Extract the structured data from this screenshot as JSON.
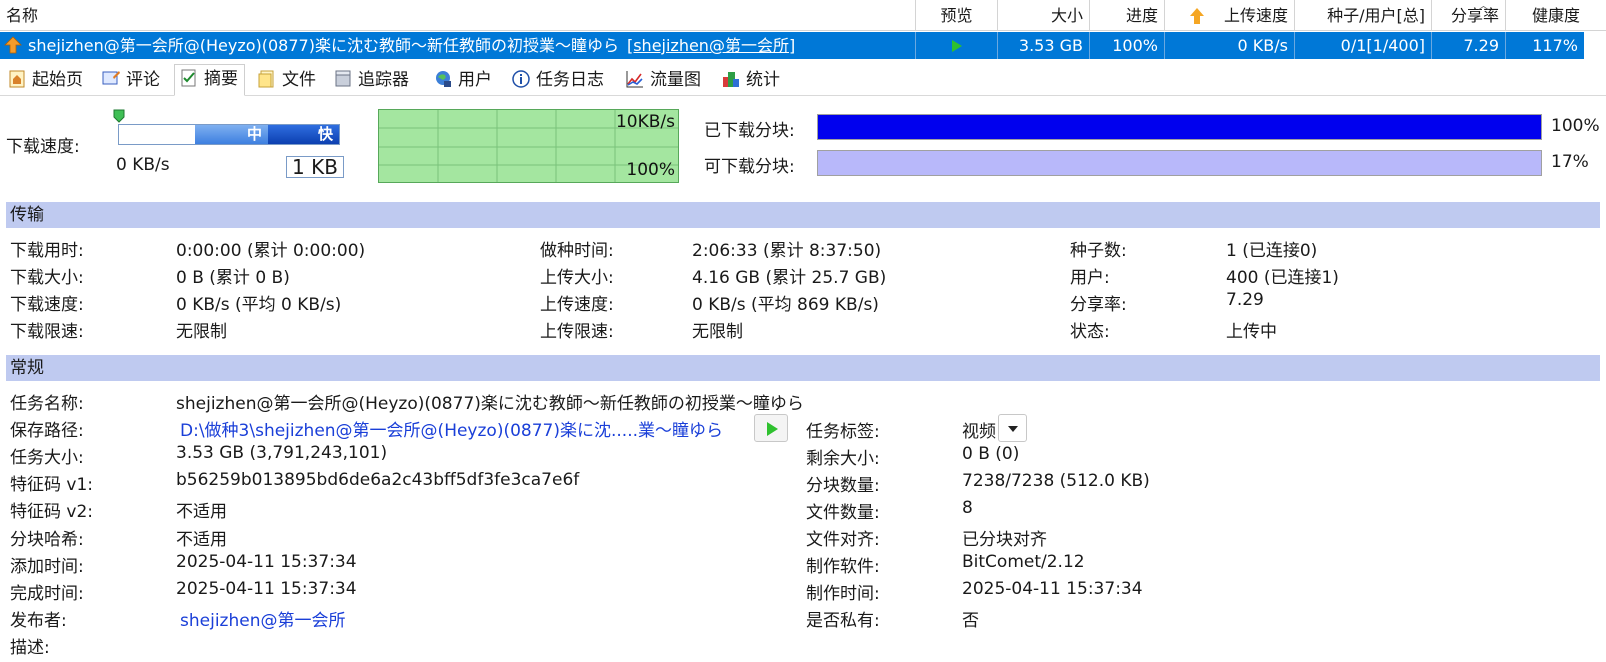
{
  "list": {
    "headers": {
      "name": "名称",
      "preview": "预览",
      "size": "大小",
      "progress": "进度",
      "upload_speed": "上传速度",
      "seeds_peers": "种子/用户[总]",
      "share_ratio": "分享率",
      "health": "健康度"
    },
    "row": {
      "name": "shejizhen@第一会所@(Heyzo)(0877)楽に沈む教師～新任教師の初授業～瞳ゆら",
      "tag": "[shejizhen@第一会所]",
      "size": "3.53 GB",
      "progress": "100%",
      "upload_speed": "0 KB/s",
      "seeds_peers": "0/1[1/400]",
      "share_ratio": "7.29",
      "health": "117%"
    }
  },
  "tabs": [
    {
      "label": "起始页",
      "icon": "home-icon"
    },
    {
      "label": "评论",
      "icon": "comment-icon"
    },
    {
      "label": "摘要",
      "icon": "summary-icon",
      "active": true
    },
    {
      "label": "文件",
      "icon": "file-icon"
    },
    {
      "label": "追踪器",
      "icon": "tracker-icon"
    },
    {
      "label": "用户",
      "icon": "peers-icon"
    },
    {
      "label": "任务日志",
      "icon": "info-icon"
    },
    {
      "label": "流量图",
      "icon": "graph-icon"
    },
    {
      "label": "统计",
      "icon": "statistics-icon"
    }
  ],
  "speed": {
    "label": "下载速度:",
    "value": "0 KB/s",
    "slider_mid": "中",
    "slider_fast": "快",
    "limit": "1 KB",
    "graph_top": "10KB/s",
    "graph_bottom": "100%"
  },
  "pieces": {
    "downloaded_label": "已下载分块:",
    "downloaded_pct": "100%",
    "downloaded_fraction": 1.0,
    "available_label": "可下载分块:",
    "available_pct": "17%",
    "available_fraction": 1.0,
    "downloaded_color": "#0000ee",
    "available_color": "#b8b8fa"
  },
  "transfer": {
    "title": "传输",
    "col1": [
      {
        "k": "下载用时:",
        "v": "0:00:00 (累计 0:00:00)"
      },
      {
        "k": "下载大小:",
        "v": "0 B (累计 0 B)"
      },
      {
        "k": "下载速度:",
        "v": "0 KB/s (平均 0 KB/s)"
      },
      {
        "k": "下载限速:",
        "v": "无限制"
      }
    ],
    "col2": [
      {
        "k": "做种时间:",
        "v": "2:06:33 (累计 8:37:50)"
      },
      {
        "k": "上传大小:",
        "v": "4.16 GB (累计 25.7 GB)"
      },
      {
        "k": "上传速度:",
        "v": "0 KB/s (平均 869 KB/s)"
      },
      {
        "k": "上传限速:",
        "v": "无限制"
      }
    ],
    "col3": [
      {
        "k": "种子数:",
        "v": "1 (已连接0)"
      },
      {
        "k": "用户:",
        "v": "400 (已连接1)"
      },
      {
        "k": "分享率:",
        "v": "7.29"
      },
      {
        "k": "状态:",
        "v": "上传中"
      }
    ]
  },
  "general": {
    "title": "常规",
    "left": [
      {
        "k": "任务名称:",
        "v": "shejizhen@第一会所@(Heyzo)(0877)楽に沈む教師～新任教師の初授業～瞳ゆら"
      },
      {
        "k": "保存路径:",
        "v": "D:\\做种3\\shejizhen@第一会所@(Heyzo)(0877)楽に沈.....業～瞳ゆら"
      },
      {
        "k": "任务大小:",
        "v": "3.53 GB (3,791,243,101)"
      },
      {
        "k": "特征码 v1:",
        "v": "b56259b013895bd6de6a2c43bff5df3fe3ca7e6f"
      },
      {
        "k": "特征码 v2:",
        "v": "不适用"
      },
      {
        "k": "分块哈希:",
        "v": "不适用"
      },
      {
        "k": "添加时间:",
        "v": "2025-04-11 15:37:34"
      },
      {
        "k": "完成时间:",
        "v": "2025-04-11 15:37:34"
      },
      {
        "k": "发布者:",
        "v": "shejizhen@第一会所"
      },
      {
        "k": "描述:",
        "v": ""
      }
    ],
    "right": [
      {
        "k": "任务标签:",
        "v": "视频"
      },
      {
        "k": "剩余大小:",
        "v": "0 B (0)"
      },
      {
        "k": "分块数量:",
        "v": "7238/7238 (512.0 KB)"
      },
      {
        "k": "文件数量:",
        "v": "8"
      },
      {
        "k": "文件对齐:",
        "v": "已分块对齐"
      },
      {
        "k": "制作软件:",
        "v": "BitComet/2.12"
      },
      {
        "k": "制作时间:",
        "v": "2025-04-11 15:37:34"
      },
      {
        "k": "是否私有:",
        "v": "否"
      }
    ]
  }
}
